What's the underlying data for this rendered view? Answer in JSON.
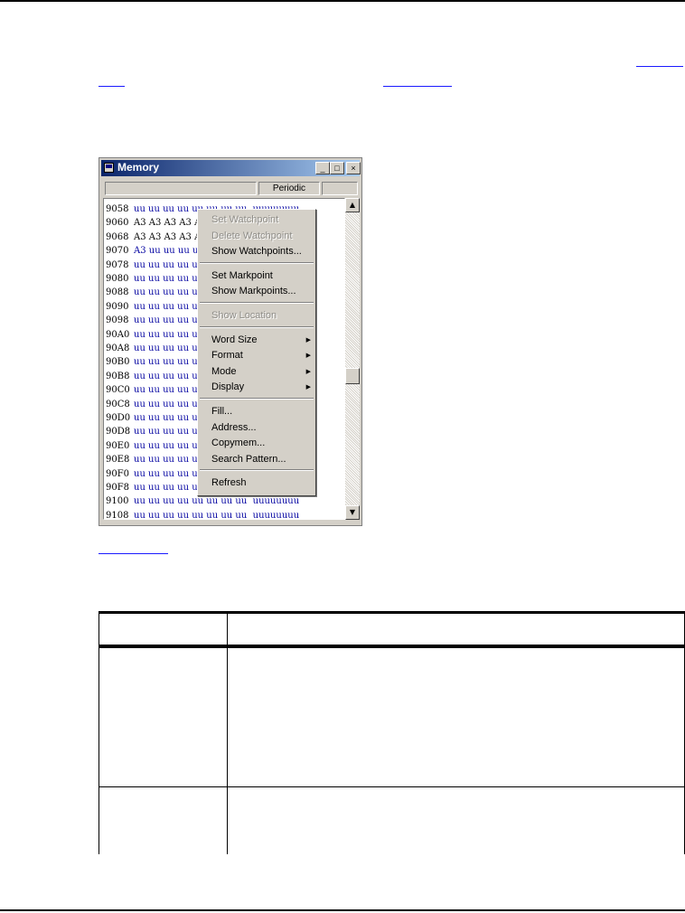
{
  "window": {
    "title": "Memory",
    "status_fields": [
      "",
      "Periodic",
      ""
    ],
    "title_buttons": {
      "minimize": "_",
      "maximize": "□",
      "close": "×"
    },
    "rows": [
      {
        "addr": "9058",
        "vals": "uu uu uu uu uu uu uu uu  uuuuuuuu",
        "dark": false
      },
      {
        "addr": "9060",
        "vals": "A3 A3 A3 A3 A3 A3 A3 A3  ........",
        "dark": true
      },
      {
        "addr": "9068",
        "vals": "A3 A3 A3 A3 A3 A3 A3 A3  ........",
        "dark": true
      },
      {
        "addr": "9070",
        "vals": "A3 uu uu uu uu uu uu uu  .uuuuuuu",
        "dark": false
      },
      {
        "addr": "9078",
        "vals": "uu uu uu uu uu uu uu uu  uuuuuuuu",
        "dark": false
      },
      {
        "addr": "9080",
        "vals": "uu uu uu uu uu uu uu uu  uuuuuuuu",
        "dark": false
      },
      {
        "addr": "9088",
        "vals": "uu uu uu uu uu uu uu uu  uuuuuuuu",
        "dark": false
      },
      {
        "addr": "9090",
        "vals": "uu uu uu uu uu uu uu uu  uuuuuuuu",
        "dark": false
      },
      {
        "addr": "9098",
        "vals": "uu uu uu uu uu uu uu uu  uuuuuuuu",
        "dark": false
      },
      {
        "addr": "90A0",
        "vals": "uu uu uu uu uu uu uu uu  uuuuuuuu",
        "dark": false
      },
      {
        "addr": "90A8",
        "vals": "uu uu uu uu uu uu uu uu  uuuuuuuu",
        "dark": false
      },
      {
        "addr": "90B0",
        "vals": "uu uu uu uu uu uu uu uu  uuuuuuuu",
        "dark": false
      },
      {
        "addr": "90B8",
        "vals": "uu uu uu uu uu uu uu uu  uuuuuuuu",
        "dark": false
      },
      {
        "addr": "90C0",
        "vals": "uu uu uu uu uu uu uu uu  uuuuuuuu",
        "dark": false
      },
      {
        "addr": "90C8",
        "vals": "uu uu uu uu uu uu uu uu  uuuuuuuu",
        "dark": false
      },
      {
        "addr": "90D0",
        "vals": "uu uu uu uu uu uu uu uu  uuuuuuuu",
        "dark": false
      },
      {
        "addr": "90D8",
        "vals": "uu uu uu uu uu uu uu uu  uuuuuuuu",
        "dark": false
      },
      {
        "addr": "90E0",
        "vals": "uu uu uu uu uu uu uu uu  uuuuuuuu",
        "dark": false
      },
      {
        "addr": "90E8",
        "vals": "uu uu uu uu uu uu uu uu  uuuuuuuu",
        "dark": false
      },
      {
        "addr": "90F0",
        "vals": "uu uu uu uu uu uu uu uu  uuuuuuuu",
        "dark": false
      },
      {
        "addr": "90F8",
        "vals": "uu uu uu uu uu uu uu uu  uuuuuuuu",
        "dark": false
      },
      {
        "addr": "9100",
        "vals": "uu uu uu uu uu uu uu uu  uuuuuuuu",
        "dark": false
      },
      {
        "addr": "9108",
        "vals": "uu uu uu uu uu uu uu uu  uuuuuuuu",
        "dark": false
      }
    ]
  },
  "context_menu": {
    "groups": [
      [
        {
          "label": "Set Watchpoint",
          "disabled": true,
          "submenu": false
        },
        {
          "label": "Delete Watchpoint",
          "disabled": true,
          "submenu": false
        },
        {
          "label": "Show Watchpoints...",
          "disabled": false,
          "submenu": false
        }
      ],
      [
        {
          "label": "Set Markpoint",
          "disabled": false,
          "submenu": false
        },
        {
          "label": "Show Markpoints...",
          "disabled": false,
          "submenu": false
        }
      ],
      [
        {
          "label": "Show Location",
          "disabled": true,
          "submenu": false
        }
      ],
      [
        {
          "label": "Word Size",
          "disabled": false,
          "submenu": true
        },
        {
          "label": "Format",
          "disabled": false,
          "submenu": true
        },
        {
          "label": "Mode",
          "disabled": false,
          "submenu": true
        },
        {
          "label": "Display",
          "disabled": false,
          "submenu": true
        }
      ],
      [
        {
          "label": "Fill...",
          "disabled": false,
          "submenu": false
        },
        {
          "label": "Address...",
          "disabled": false,
          "submenu": false
        },
        {
          "label": "Copymem...",
          "disabled": false,
          "submenu": false
        },
        {
          "label": "Search Pattern...",
          "disabled": false,
          "submenu": false
        }
      ],
      [
        {
          "label": "Refresh",
          "disabled": false,
          "submenu": false
        }
      ]
    ],
    "submenu_arrow": "▶"
  },
  "colors": {
    "title_gradient_start": "#0a246a",
    "title_gradient_end": "#a6caf0",
    "memory_value_blue": "#0000a0",
    "link_blue": "#1a1aff"
  }
}
